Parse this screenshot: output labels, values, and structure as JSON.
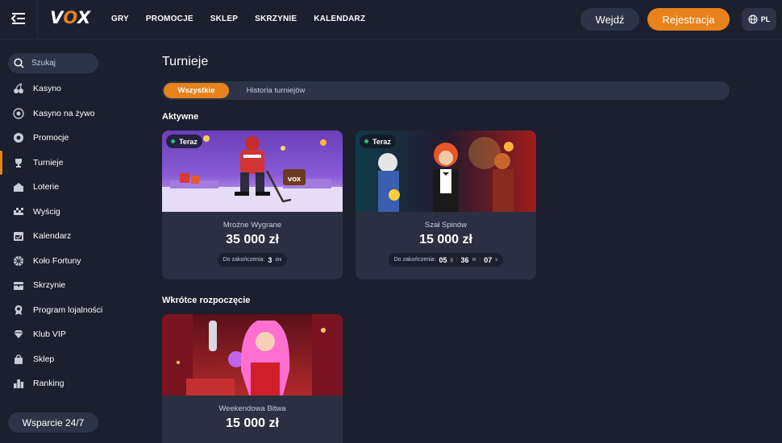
{
  "header": {
    "logo": {
      "v": "V",
      "o": "O",
      "x": "X"
    },
    "nav": [
      "GRY",
      "PROMOCJE",
      "SKLEP",
      "SKRZYNIE",
      "KALENDARZ"
    ],
    "login_label": "Wejdź",
    "register_label": "Rejestracja",
    "language": "PL"
  },
  "sidebar": {
    "search_placeholder": "Szukaj",
    "items": [
      {
        "label": "Kasyno",
        "icon": "cherry-icon"
      },
      {
        "label": "Kasyno na żywo",
        "icon": "roulette-icon"
      },
      {
        "label": "Promocje",
        "icon": "gift-icon"
      },
      {
        "label": "Turnieje",
        "icon": "trophy-icon",
        "active": true
      },
      {
        "label": "Loterie",
        "icon": "lottery-icon"
      },
      {
        "label": "Wyścig",
        "icon": "flag-icon"
      },
      {
        "label": "Kalendarz",
        "icon": "calendar-icon"
      },
      {
        "label": "Koło Fortuny",
        "icon": "wheel-icon"
      },
      {
        "label": "Skrzynie",
        "icon": "chest-icon"
      },
      {
        "label": "Program lojalności",
        "icon": "medal-icon"
      },
      {
        "label": "Klub VIP",
        "icon": "diamond-icon"
      },
      {
        "label": "Sklep",
        "icon": "bag-icon"
      },
      {
        "label": "Ranking",
        "icon": "ranking-icon"
      }
    ],
    "support_label": "Wsparcie 24/7"
  },
  "main": {
    "title": "Turnieje",
    "tabs": [
      "Wszystkie",
      "Historia turniejów"
    ],
    "sections": {
      "active": "Aktywne",
      "upcoming": "Wkrótce rozpoczęcie"
    },
    "active_tournaments": [
      {
        "badge": "Teraz",
        "name": "Mroźne Wygrane",
        "prize": "35 000 zł",
        "ends_label": "Do zakończenia:",
        "countdown": {
          "days": "3",
          "days_unit": "dni"
        }
      },
      {
        "badge": "Teraz",
        "name": "Szał Spinów",
        "prize": "15 000 zł",
        "ends_label": "Do zakończenia:",
        "countdown": {
          "h": "05",
          "h_unit": "g",
          "sep1": ":",
          "m": "36",
          "m_unit": "m",
          "sep2": ":",
          "s": "07",
          "s_unit": "s"
        }
      }
    ],
    "upcoming_tournaments": [
      {
        "name": "Weekendowa Bitwa",
        "prize": "15 000 zł"
      }
    ]
  },
  "colors": {
    "accent": "#e8821a",
    "background": "#1b1f2e",
    "card": "#2a3042",
    "pill": "#2e3448",
    "live_dot": "#23c06b"
  }
}
